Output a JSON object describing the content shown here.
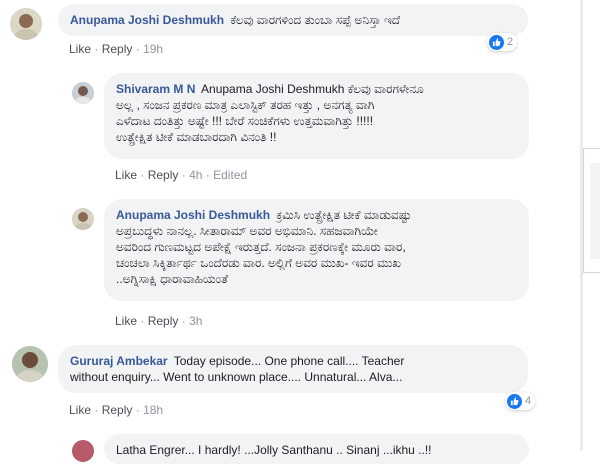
{
  "actions": {
    "like": "Like",
    "reply": "Reply",
    "separator": "·"
  },
  "comments": [
    {
      "author": "Anupama Joshi Deshmukh",
      "text": "ಕೆಲವು ವಾರಗಳಿಂದ ತುಂಬಾ ಸಪ್ಪೆ ಅನಿಸ್ತಾ ಇದೆ",
      "time": "19h",
      "reaction_count": "2",
      "replies": [
        {
          "author": "Shivaram M N",
          "lines": [
            "Anupama Joshi Deshmukh ಕೆಲವು ವಾರಗಳೇನೂ",
            "ಅಲ್ಲ , ಸಂಜನ ಪ್ರಕರಣ ಮಾತ್ರ ಎಲಾಸ್ಟಿಕ್ ತರಹ ಇತ್ತು , ಅನಗತ್ಯ ವಾಗಿ",
            "ಎಳೆದಾಟ ದಂತಿತ್ತು ಅಷ್ಟೇ !!! ಬೇರೆ ಸಂಚಿಕೆಗಳು ಉತ್ತಮವಾಗಿತ್ತು !!!!!",
            "ಉತ್ಪ್ರೇಕ್ಷಿತ ಟೀಕೆ ಮಾಡಬಾರದಾಗಿ ವಿನಂತಿ !!"
          ],
          "time": "4h",
          "edited": "Edited"
        },
        {
          "author": "Anupama Joshi Deshmukh",
          "lines": [
            "ಕ್ರಮಿಸಿ ಉತ್ಪ್ರೇಕ್ಷಿತ ಟೀಕೆ ಮಾಡುವಷ್ಟು",
            "ಅಪ್ರಬುದ್ಧಳು ನಾನಲ್ಲ. ಸೀತಾರಾಮ್ ಅವರ ಅಭಿಮಾನಿ. ಸಹಜವಾಗಿಯೇ",
            "ಅವರಿಂದ ಗುಣಮಟ್ಟದ ಅಪೇಕ್ಷೆ ಇರುತ್ತದೆ. ಸಂಜನಾ ಪ್ರಕರಣಕ್ಕೇ ಮೂರು ವಾರ,",
            "ಚಂಚಲಾ ಸಿಕ್ಕಿರ್ತಾರ್ಥ ಒಂದೆರಡು ವಾರ. ಅಲ್ಲಿಗೆ ಅವರ ಮುಖ- ಇವರ ಮುಖ",
            "..ಅಗ್ನಿಸಾಕ್ಷಿ ಧಾರಾವಾಹಿಯಂತೆ"
          ],
          "time": "3h"
        }
      ]
    },
    {
      "author": "Gururaj Ambekar",
      "lines": [
        "Today episode... One phone call.... Teacher",
        "without enquiry... Went to unknown place.... Unnatural... Alva..."
      ],
      "time": "18h",
      "reaction_count": "4"
    }
  ],
  "partial_comment": {
    "text": "Latha Engrer... I hardly! ...Jolly Santhanu .. Sinanj ...ikhu ..!!"
  },
  "colors": {
    "author": "#385898",
    "bubble": "#f2f3f5",
    "action_link": "#4b4f56",
    "meta": "#90949c",
    "like_blue": "#1877f2"
  },
  "icons": [
    "like-reaction-icon",
    "thumbs-up-icon"
  ]
}
